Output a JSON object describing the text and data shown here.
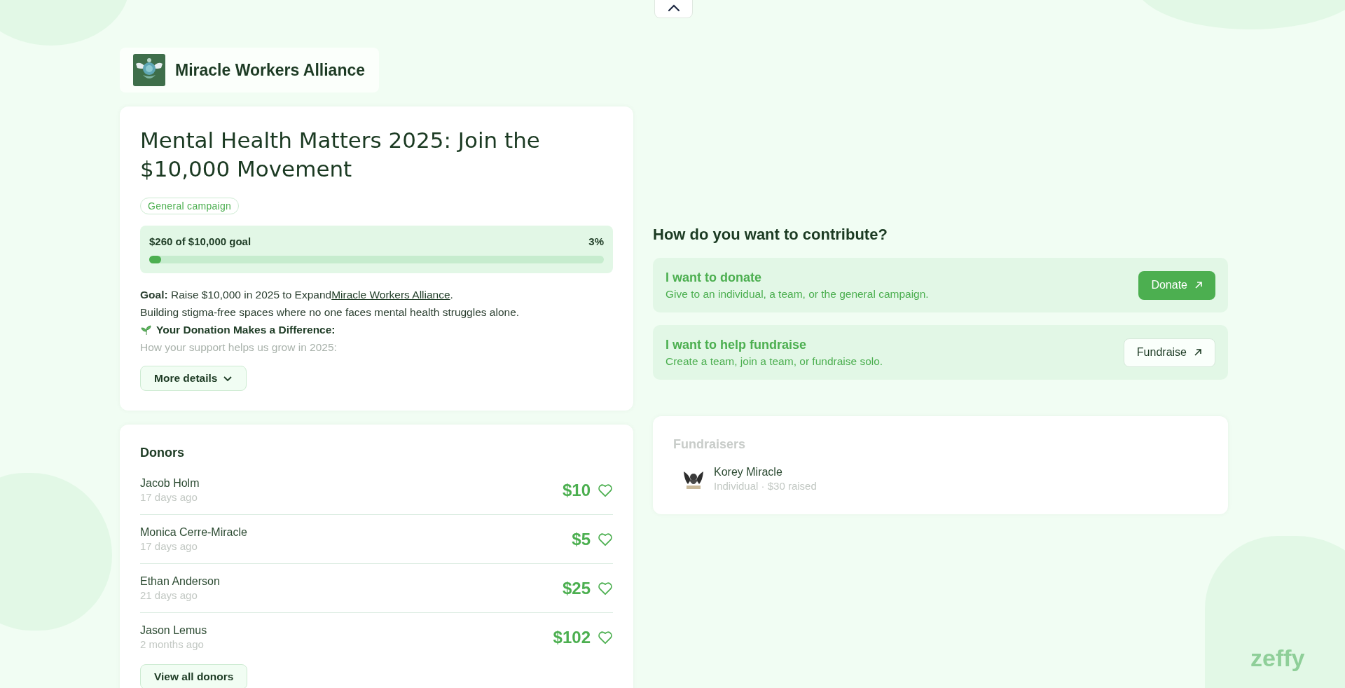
{
  "organization": {
    "name": "Miracle Workers Alliance"
  },
  "campaign": {
    "title": "Mental Health Matters 2025: Join the $10,000 Movement",
    "tag": "General campaign",
    "progress": {
      "raised": "$260 of $10,000 goal",
      "percent": "3%",
      "level": 0.026
    },
    "goal": {
      "prefix": "**Goal:** Raise $10,000 in 2025 to Expand",
      "link": "Miracle Workers Alliance",
      "suffix": "."
    },
    "mission": "Building stigma-free spaces where no one faces mental health struggles alone.",
    "subheading": "Your Donation Makes a Difference:",
    "faded_line": "How your support helps us grow in 2025:",
    "more_button": "More details"
  },
  "donors": {
    "title": "Donors",
    "items": [
      {
        "name": "Jacob Holm",
        "time": "17 days ago",
        "amount": "$10"
      },
      {
        "name": "Monica Cerre-Miracle",
        "time": "17 days ago",
        "amount": "$5"
      },
      {
        "name": "Ethan Anderson",
        "time": "21 days ago",
        "amount": "$25"
      },
      {
        "name": "Jason Lemus",
        "time": "2 months ago",
        "amount": "$102"
      }
    ],
    "view_all": "View all donors"
  },
  "contribute": {
    "title": "How do you want to contribute?",
    "options": [
      {
        "kind": "primary",
        "title": "I want to donate",
        "subtitle": "Give to an individual, a team, or the general campaign.",
        "button": "Donate"
      },
      {
        "kind": "secondary",
        "title": "I want to help fundraise",
        "subtitle": "Create a team, join a team, or fundraise solo.",
        "button": "Fundraise"
      }
    ]
  },
  "fundraisers": {
    "title": "Fundraisers",
    "items": [
      {
        "name": "Korey Miracle",
        "detail": "Individual · $30 raised"
      }
    ]
  },
  "brand": "zeffy"
}
